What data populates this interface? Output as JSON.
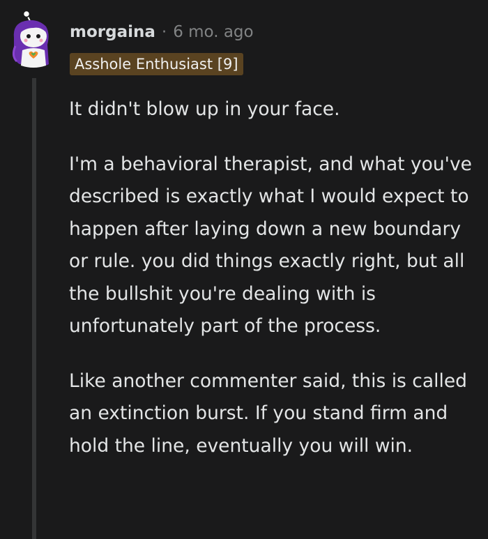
{
  "comment": {
    "author": "morgaina",
    "separator": "·",
    "time_ago": "6 mo. ago",
    "flair": "Asshole Enthusiast [9]",
    "avatar_icon": "snoo-avatar-icon",
    "paragraphs": [
      "It didn't blow up in your face.",
      "I'm a behavioral therapist, and what you've described is exactly what I would expect to happen after laying down a new boundary or rule. you did things exactly right, but all the bullshit you're dealing with is unfortunately part of the process.",
      "Like another commenter said, this is called an extinction burst. If you stand firm and hold the line, eventually you will win."
    ]
  },
  "colors": {
    "background": "#1a1a1b",
    "text": "#d7dadc",
    "meta": "#818384",
    "flair_bg": "#5a4321",
    "thread_line": "#343536",
    "avatar_hair": "#6a2fb0"
  }
}
